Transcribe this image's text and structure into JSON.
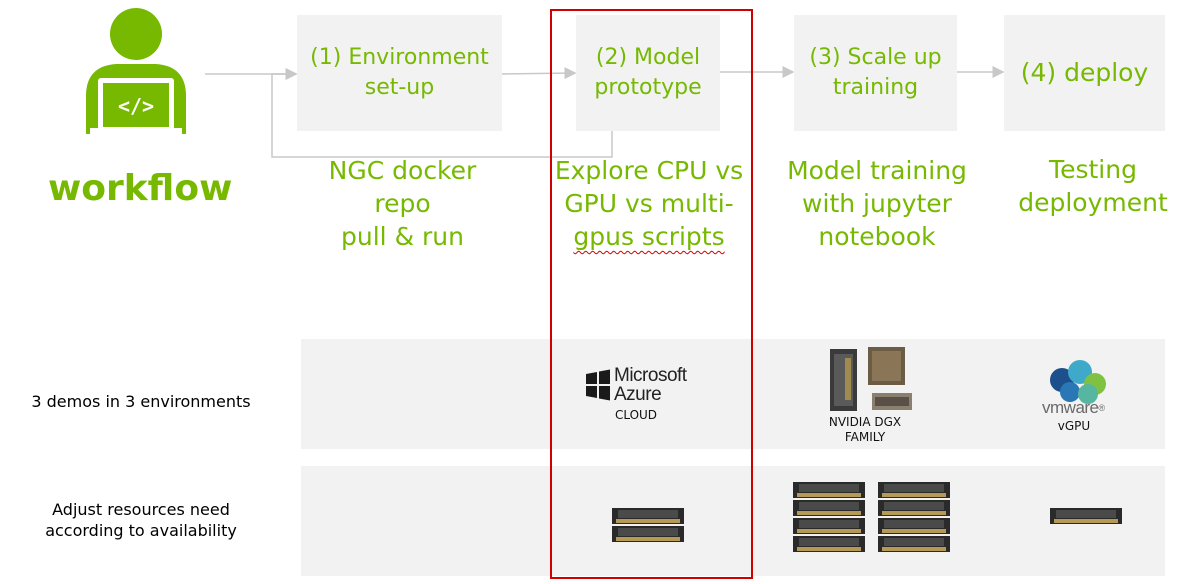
{
  "title": "workflow",
  "colors": {
    "accent": "#76b900",
    "highlight": "#d00000",
    "panel": "#f2f2f2"
  },
  "icons": [
    "developer-icon",
    "microsoft-windows-logo-icon",
    "nvidia-dgx-servers-icon",
    "vmware-logo-icon",
    "gpu-card-icon"
  ],
  "steps": [
    {
      "label": "(1) Environment set-up",
      "line1": "(1) Environment",
      "line2": "set-up",
      "description": [
        "NGC docker",
        "repo",
        "pull & run"
      ]
    },
    {
      "label": "(2) Model prototype",
      "line1": "(2) Model",
      "line2": "prototype",
      "description": [
        "Explore CPU vs",
        "GPU vs multi-",
        "gpus scripts"
      ]
    },
    {
      "label": "(3) Scale up training",
      "line1": "(3) Scale up",
      "line2": "training",
      "description": [
        "Model training",
        "with jupyter",
        "notebook"
      ]
    },
    {
      "label": "(4) deploy",
      "line1": "(4) deploy",
      "line2": "",
      "description": [
        "Testing",
        "deployment"
      ]
    }
  ],
  "rows": [
    {
      "label": "3 demos in 3 environments"
    },
    {
      "label_line1": "Adjust resources need",
      "label_line2": "according to availability"
    }
  ],
  "environments": {
    "azure": {
      "brand_line1": "Microsoft",
      "brand_line2": "Azure",
      "caption": "CLOUD"
    },
    "dgx": {
      "caption_line1": "NVIDIA DGX",
      "caption_line2": "FAMILY"
    },
    "vmware": {
      "brand": "vmware",
      "reg": "®",
      "caption": "vGPU"
    }
  },
  "resources": {
    "azure_gpus": 2,
    "dgx_gpus": 8,
    "vmware_gpus": 1
  }
}
